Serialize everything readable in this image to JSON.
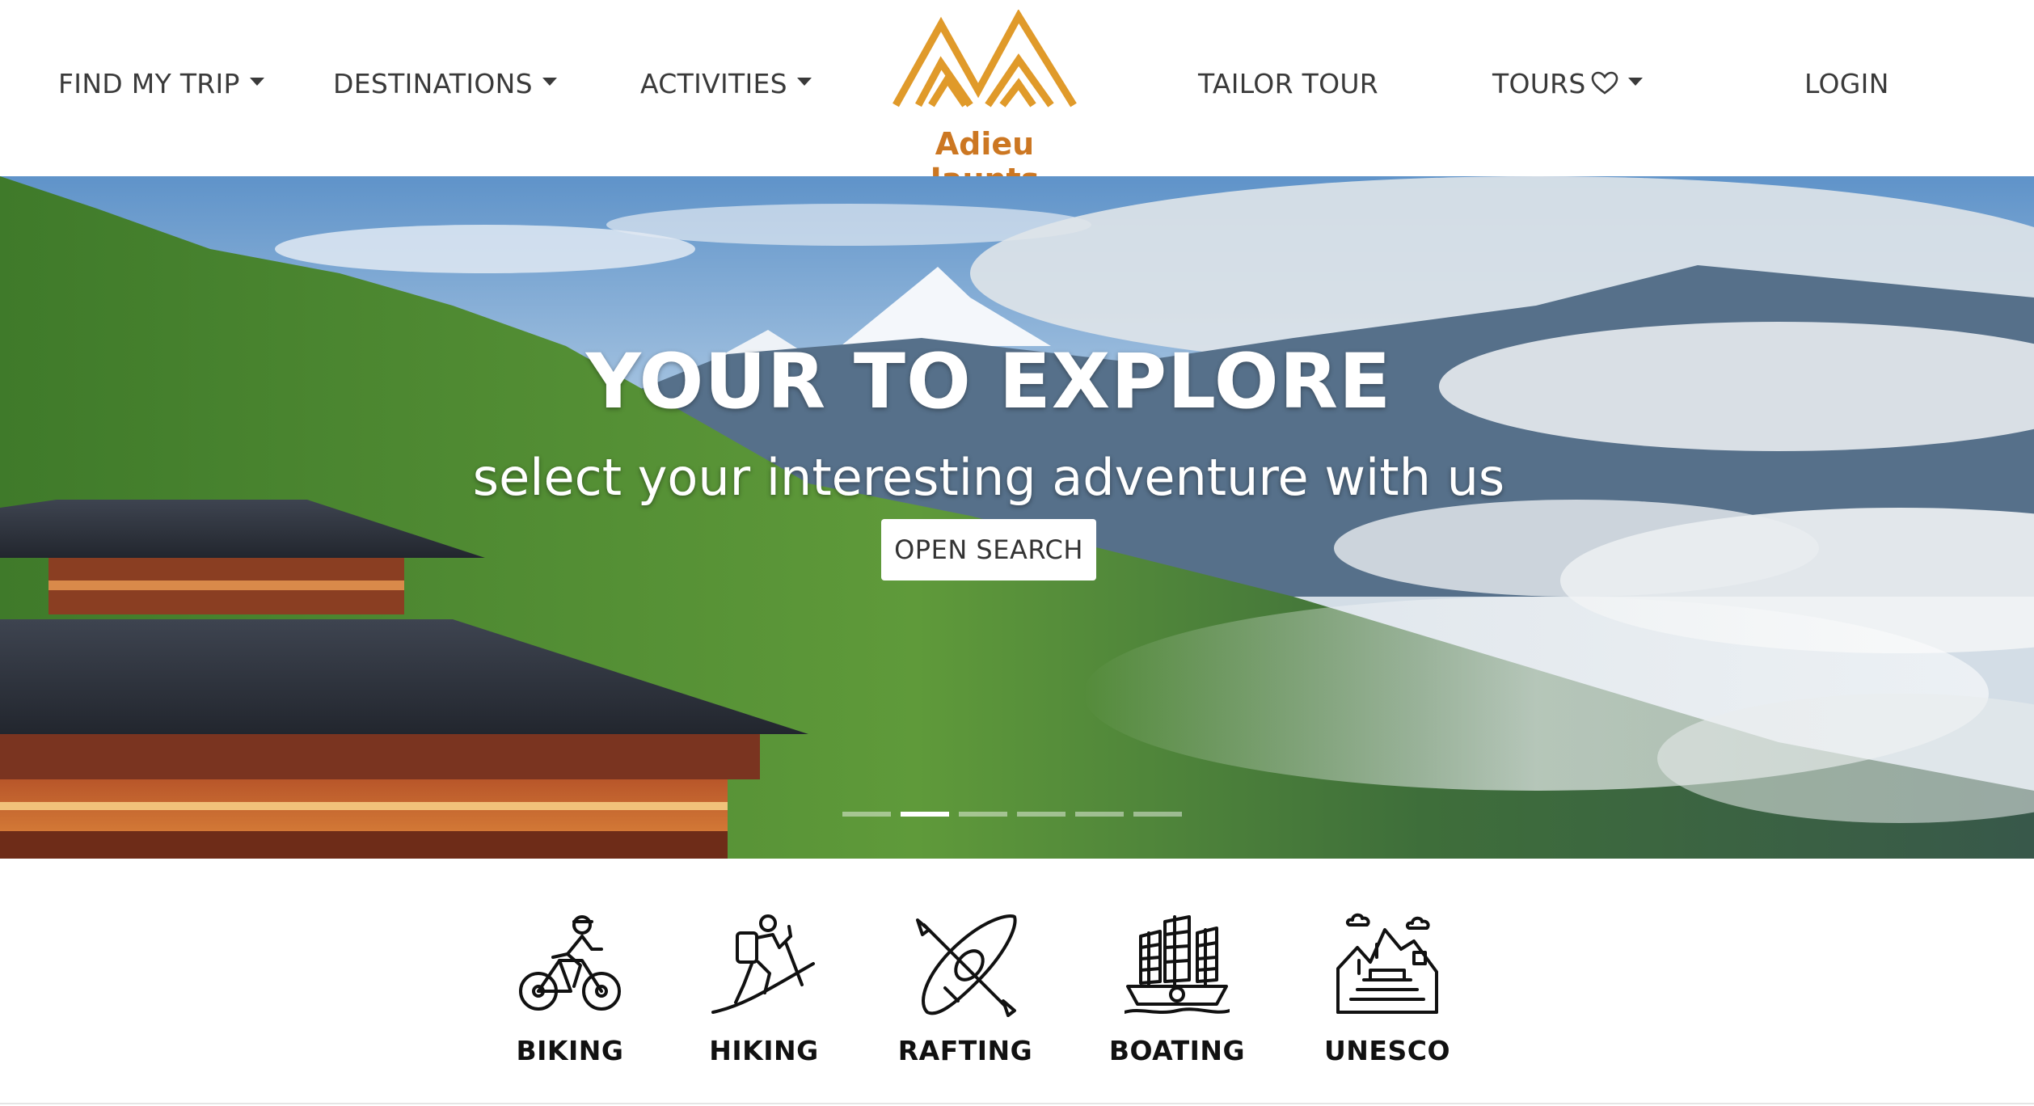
{
  "nav": {
    "left": [
      {
        "label": "FIND MY TRIP",
        "dropdown": true
      },
      {
        "label": "DESTINATIONS",
        "dropdown": true
      },
      {
        "label": "ACTIVITIES",
        "dropdown": true
      }
    ],
    "right": [
      {
        "label": "TAILOR TOUR",
        "dropdown": false
      },
      {
        "label": "TOURS",
        "dropdown": true,
        "icon": "heart-outline-icon"
      },
      {
        "label": "LOGIN",
        "dropdown": false
      }
    ],
    "brand": {
      "name": "Adieu Jaunts",
      "logo_icon": "mountains-logo-icon",
      "color": "#cc7722",
      "accent": "#e09a2a"
    }
  },
  "hero": {
    "title": "YOUR TO EXPLORE",
    "subtitle": "select your interesting adventure with us",
    "button": "OPEN SEARCH",
    "slides_total": 6,
    "active_slide": 2
  },
  "activities": [
    {
      "label": "BIKING",
      "icon": "cyclist-icon"
    },
    {
      "label": "HIKING",
      "icon": "hiker-icon"
    },
    {
      "label": "RAFTING",
      "icon": "kayak-icon"
    },
    {
      "label": "BOATING",
      "icon": "junk-boat-icon"
    },
    {
      "label": "UNESCO",
      "icon": "heritage-site-icon"
    }
  ],
  "colors": {
    "nav_text": "#3a3a3a",
    "brand_orange": "#cc7722",
    "logo_gold": "#e09a2a",
    "activity_text": "#111111"
  }
}
